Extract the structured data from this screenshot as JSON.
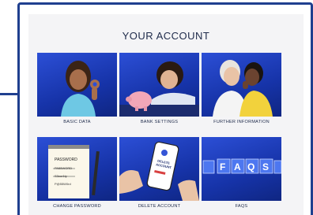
{
  "page": {
    "title": "YOUR ACCOUNT"
  },
  "tiles": [
    {
      "label": "BASIC DATA",
      "icon": "woman-ok-gesture-photo"
    },
    {
      "label": "BANK SETTINGS",
      "icon": "piggy-bank-photo"
    },
    {
      "label": "FURTHER INFORMATION",
      "icon": "women-whispering-photo"
    },
    {
      "label": "CHANGE PASSWORD",
      "icon": "password-notepad-photo"
    },
    {
      "label": "DELETE ACCOUNT",
      "icon": "phone-delete-account-photo"
    },
    {
      "label": "FAQS",
      "icon": "faqs-cubes-photo"
    }
  ],
  "colors": {
    "frame": "#1f3f8f",
    "tile_bg": "#1a3bb8",
    "text": "#1e2a4a"
  }
}
